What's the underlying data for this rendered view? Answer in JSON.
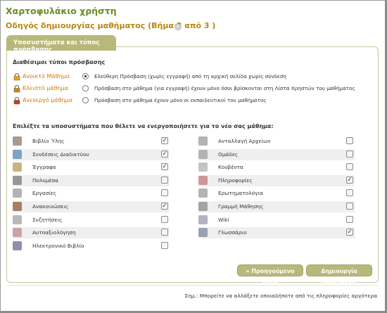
{
  "page": {
    "title": "Χαρτοφυλάκιο χρήστη",
    "wizard_title": "Οδηγός δημιουργίας μαθήματος (Βήμα 3 από 3 )",
    "help_icon": "help-icon"
  },
  "panel": {
    "tab_label": "Υποσυστήματα και τύπος πρόσβασης",
    "access_heading": "Διαθέσιμοι τύποι πρόσβασης",
    "access_types": [
      {
        "label": "Ανοικτό Μάθημα",
        "description": "Ελεύθερη Πρόσβαση (χωρίς εγγραφή) από τη αρχική σελίδα χωρίς σύνδεση",
        "selected": true,
        "icon": "open-lock-icon"
      },
      {
        "label": "Κλειστό μάθημα",
        "description": "Πρόσβαση στο μάθημα (για εγγραφή) έχουν μόνο όσοι βρίσκονται στη Λίστα Χρηστών του μαθήματος",
        "selected": false,
        "icon": "closed-lock-icon"
      },
      {
        "label": "Ανενεργό μάθημα",
        "description": "Πρόσβαση στο μάθημα έχουν μόνο οι εκπαιδευτικοί του μαθήματος",
        "selected": false,
        "icon": "inactive-lock-icon"
      }
    ],
    "tools_heading": "Επιλέξτε τα υποσυστήματα που θέλετε να ενεργοποιήσετε για το νέο σας μάθημα:",
    "tools_left": [
      {
        "label": "Βιβλίο Ύλης",
        "checked": true,
        "icon": "book-icon"
      },
      {
        "label": "Συνδέσεις Διαδικτύου",
        "checked": true,
        "icon": "links-icon"
      },
      {
        "label": "Έγγραφα",
        "checked": true,
        "icon": "folder-icon"
      },
      {
        "label": "Πολυμέσα",
        "checked": false,
        "icon": "multimedia-icon"
      },
      {
        "label": "Εργασίες",
        "checked": false,
        "icon": "assignments-icon"
      },
      {
        "label": "Ανακοινώσεις",
        "checked": true,
        "icon": "announcements-icon"
      },
      {
        "label": "Συζητήσεις",
        "checked": false,
        "icon": "forum-icon"
      },
      {
        "label": "Αυτοαξιολόγηση",
        "checked": false,
        "icon": "self-assessment-icon"
      },
      {
        "label": "Ηλεκτρονικό Βιβλίο",
        "checked": false,
        "icon": "ebook-icon"
      }
    ],
    "tools_right": [
      {
        "label": "Ανταλλαγή Αρχείων",
        "checked": false,
        "icon": "file-exchange-icon"
      },
      {
        "label": "Ομάδες",
        "checked": false,
        "icon": "groups-icon"
      },
      {
        "label": "Κουβέντα",
        "checked": false,
        "icon": "chat-icon"
      },
      {
        "label": "Πληροφορίες",
        "checked": true,
        "icon": "info-icon"
      },
      {
        "label": "Ερωτηματολόγια",
        "checked": false,
        "icon": "questionnaire-icon"
      },
      {
        "label": "Γραμμή Μάθησης",
        "checked": false,
        "icon": "learning-path-icon"
      },
      {
        "label": "Wiki",
        "checked": false,
        "icon": "wiki-icon"
      },
      {
        "label": "Γλωσσάριο",
        "checked": true,
        "icon": "glossary-icon"
      }
    ],
    "back_button": "« Προηγούμενο βήμα",
    "create_button": "Δημιουργία μαθήματος!"
  },
  "footer_note": "Σημ.: Μπορείτε να αλλάξετε οποιαδήποτε από τις πληροφορίες αργότερα",
  "colors": {
    "title_green": "#6b8e23",
    "wizard_gold": "#b8860b",
    "accent_khaki": "#b8b87a",
    "access_orange": "#d97700"
  }
}
